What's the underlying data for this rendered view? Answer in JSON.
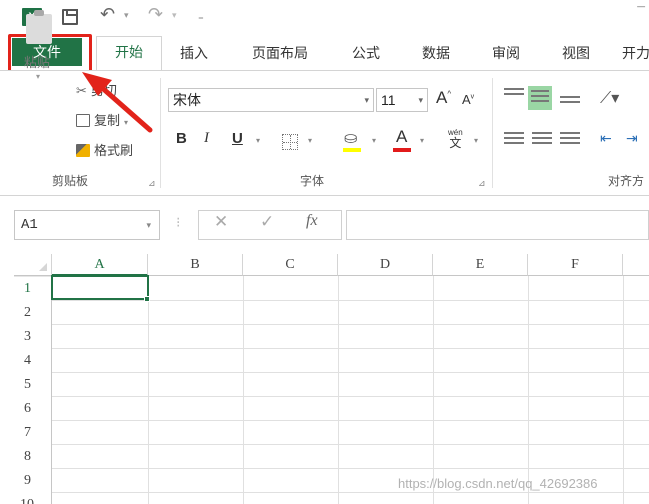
{
  "qat": {
    "excel_icon": "X",
    "icons": [
      "excel-icon",
      "save-icon",
      "undo-icon",
      "redo-icon",
      "customize-qat-icon"
    ]
  },
  "tabs": {
    "file": "文件",
    "home": "开始",
    "insert": "插入",
    "page_layout": "页面布局",
    "formulas": "公式",
    "data": "数据",
    "review": "审阅",
    "view": "视图",
    "developer": "开力"
  },
  "ribbon": {
    "clipboard": {
      "paste": "粘贴",
      "cut": "剪切",
      "copy": "复制",
      "format_painter": "格式刷",
      "label": "剪贴板"
    },
    "font": {
      "font_name": "宋体",
      "font_size": "11",
      "grow": "A",
      "shrink": "A",
      "bold": "B",
      "italic": "I",
      "underline": "U",
      "phonetic_top": "wén",
      "phonetic_bottom": "文",
      "label": "字体"
    },
    "alignment": {
      "label": "对齐方"
    }
  },
  "formula_bar": {
    "name_box": "A1",
    "fx": "fx",
    "formula": ""
  },
  "sheet": {
    "columns": [
      "A",
      "B",
      "C",
      "D",
      "E",
      "F"
    ],
    "rows": [
      "1",
      "2",
      "3",
      "4",
      "5",
      "6",
      "7",
      "8",
      "9",
      "10"
    ],
    "selected_cell": "A1"
  },
  "annotation": {
    "highlight_color": "#e2231a",
    "target": "file-tab"
  },
  "colors": {
    "excel_green": "#217346",
    "fill_color": "#ffff00",
    "font_color": "#e21b1b"
  },
  "watermark": "https://blog.csdn.net/qq_42692386"
}
